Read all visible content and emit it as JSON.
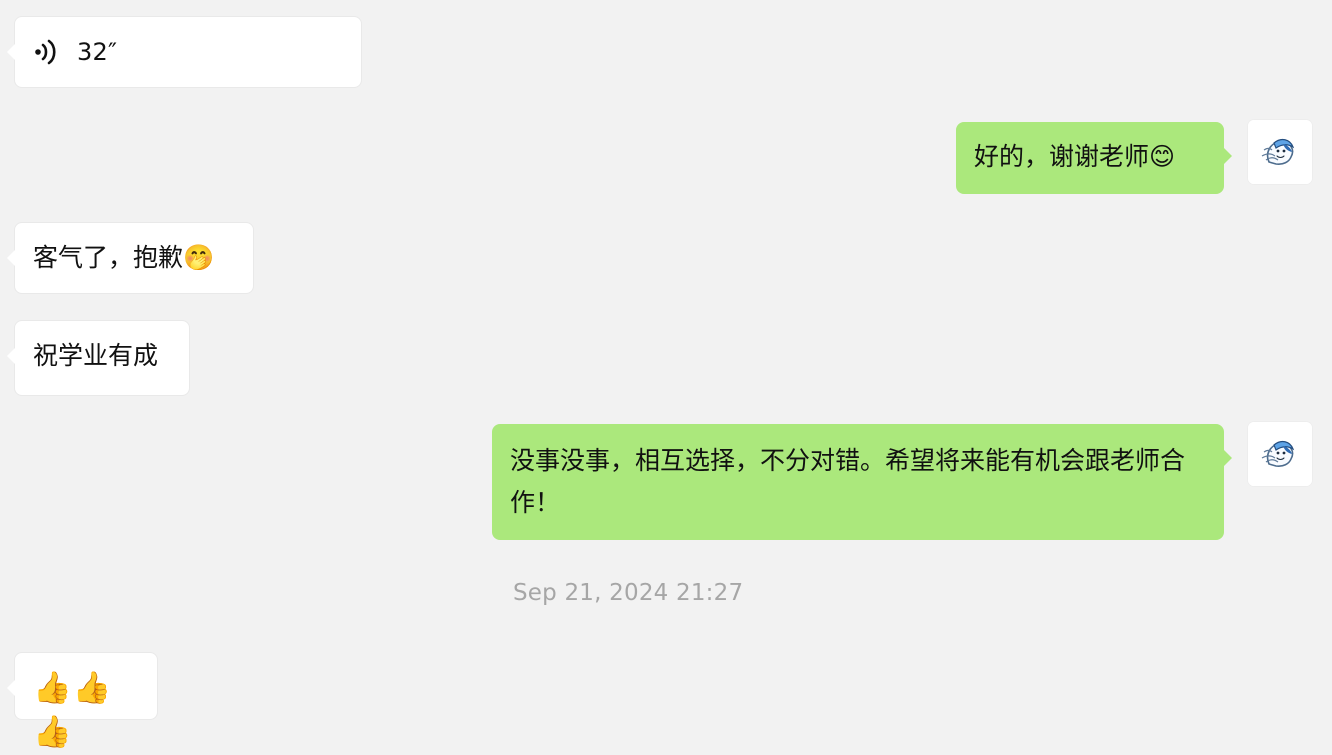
{
  "chat": {
    "messages": [
      {
        "type": "voice",
        "direction": "incoming",
        "duration": "32″",
        "icon": "voice-icon"
      },
      {
        "type": "text",
        "direction": "outgoing",
        "text": "好的，谢谢老师😊",
        "avatar_icon": "avatar-icon"
      },
      {
        "type": "text",
        "direction": "incoming",
        "text": "客气了，抱歉🤭"
      },
      {
        "type": "text",
        "direction": "incoming",
        "text": "祝学业有成"
      },
      {
        "type": "text",
        "direction": "outgoing",
        "text": "没事没事，相互选择，不分对错。希望将来能有机会跟老师合作！",
        "avatar_icon": "avatar-icon"
      },
      {
        "type": "timestamp",
        "text": "Sep 21, 2024 21:27"
      },
      {
        "type": "text",
        "direction": "incoming",
        "text": "👍👍👍"
      }
    ]
  },
  "colors": {
    "background": "#f2f2f2",
    "incoming_bubble": "#ffffff",
    "outgoing_bubble": "#abe87c",
    "timestamp": "#a6a6a6",
    "text": "#111111"
  }
}
